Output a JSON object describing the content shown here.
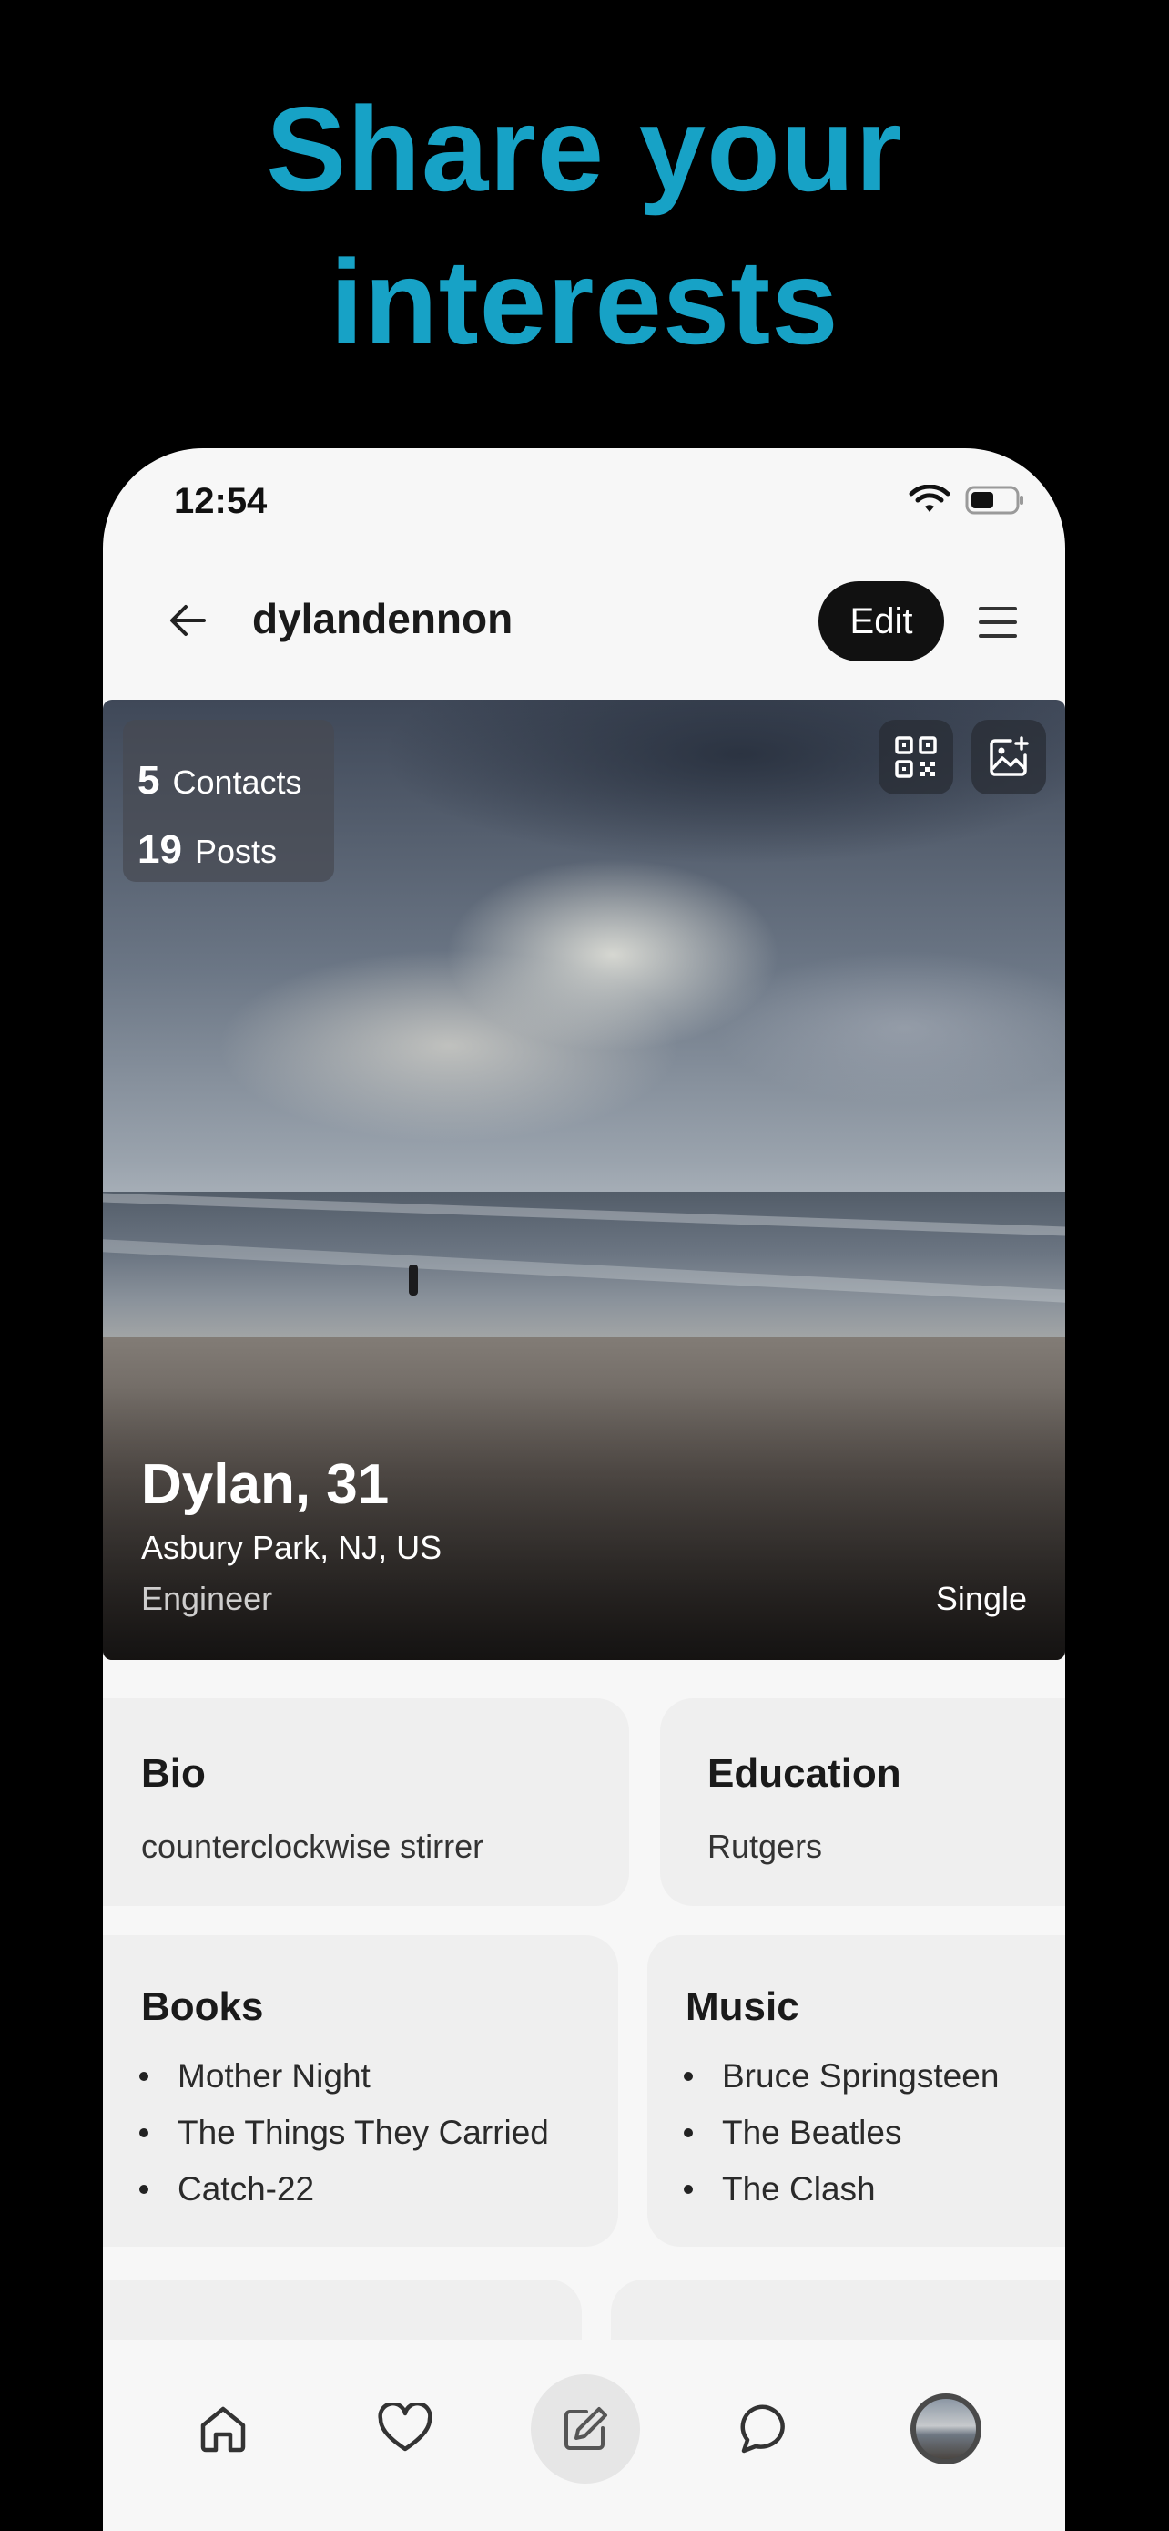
{
  "promo": {
    "headline_line1": "Share your",
    "headline_line2": "interests"
  },
  "status_bar": {
    "time": "12:54"
  },
  "app_bar": {
    "username": "dylandennon",
    "edit_label": "Edit"
  },
  "profile": {
    "stats": [
      {
        "count": "5",
        "label": "Contacts"
      },
      {
        "count": "19",
        "label": "Posts"
      }
    ],
    "name_age": "Dylan, 31",
    "location": "Asbury Park, NJ, US",
    "occupation": "Engineer",
    "relationship": "Single"
  },
  "cards": {
    "bio": {
      "title": "Bio",
      "text": "counterclockwise stirrer"
    },
    "education": {
      "title": "Education",
      "text": "Rutgers"
    },
    "books": {
      "title": "Books",
      "items": [
        "Mother Night",
        "The Things They Carried",
        "Catch-22"
      ]
    },
    "music": {
      "title": "Music",
      "items": [
        "Bruce Springsteen",
        "The Beatles",
        "The Clash"
      ]
    }
  },
  "tab_bar": {
    "icons": [
      "home-icon",
      "heart-icon",
      "compose-icon",
      "chat-icon",
      "avatar"
    ],
    "active": "compose-icon"
  },
  "colors": {
    "headline": "#17a2c6",
    "background": "#000000",
    "card": "#efefef",
    "edit_button": "#111111"
  }
}
